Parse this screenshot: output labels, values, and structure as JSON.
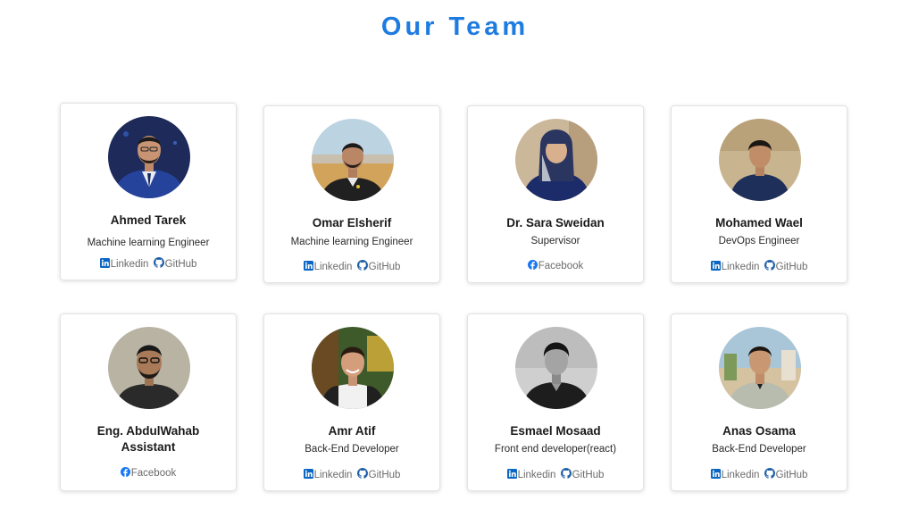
{
  "page": {
    "title": "Our Team"
  },
  "colors": {
    "accent": "#1e7be0",
    "linkedin": "#0a66c2",
    "github": "#1f5fa8",
    "facebook": "#1877f2",
    "link_text": "#6b6b6b"
  },
  "members": [
    {
      "name": "Ahmed Tarek",
      "role": "Machine learning Engineer",
      "links": [
        {
          "label": "Linkedin",
          "icon": "linkedin-icon"
        },
        {
          "label": "GitHub",
          "icon": "github-icon"
        }
      ]
    },
    {
      "name": "Omar Elsherif",
      "role": "Machine learning Engineer",
      "links": [
        {
          "label": "Linkedin",
          "icon": "linkedin-icon"
        },
        {
          "label": "GitHub",
          "icon": "github-icon"
        }
      ]
    },
    {
      "name": "Dr. Sara Sweidan",
      "role": "Supervisor",
      "links": [
        {
          "label": "Facebook",
          "icon": "facebook-icon"
        }
      ]
    },
    {
      "name": "Mohamed Wael",
      "role": "DevOps Engineer",
      "links": [
        {
          "label": "Linkedin",
          "icon": "linkedin-icon"
        },
        {
          "label": "GitHub",
          "icon": "github-icon"
        }
      ]
    },
    {
      "name": "Eng. AbdulWahab\nAssistant",
      "role": "",
      "links": [
        {
          "label": "Facebook",
          "icon": "facebook-icon"
        }
      ]
    },
    {
      "name": "Amr Atif",
      "role": "Back-End Developer",
      "links": [
        {
          "label": "Linkedin",
          "icon": "linkedin-icon"
        },
        {
          "label": "GitHub",
          "icon": "github-icon"
        }
      ]
    },
    {
      "name": "Esmael Mosaad",
      "role": "Front end developer(react)",
      "links": [
        {
          "label": "Linkedin",
          "icon": "linkedin-icon"
        },
        {
          "label": "GitHub",
          "icon": "github-icon"
        }
      ]
    },
    {
      "name": "Anas Osama",
      "role": "Back-End Developer",
      "links": [
        {
          "label": "Linkedin",
          "icon": "linkedin-icon"
        },
        {
          "label": "GitHub",
          "icon": "github-icon"
        }
      ]
    }
  ]
}
